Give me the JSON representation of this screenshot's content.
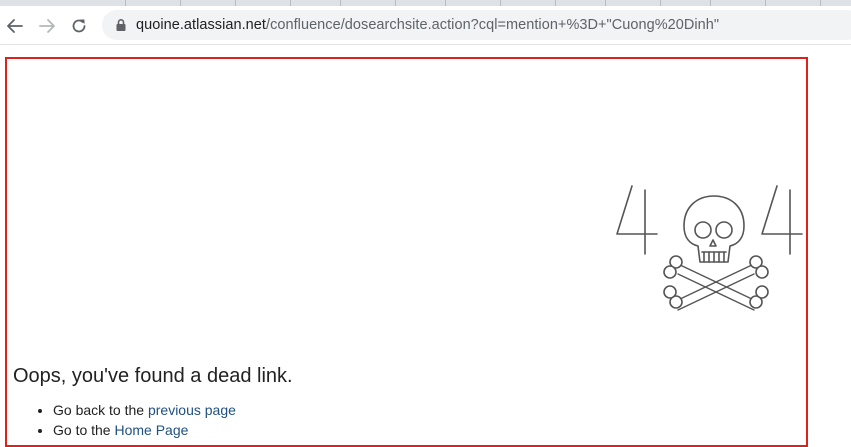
{
  "browser": {
    "back_icon": "arrow-left-icon",
    "forward_icon": "arrow-right-icon",
    "reload_icon": "reload-icon",
    "lock_icon": "lock-icon",
    "url_host": "quoine.atlassian.net",
    "url_path": "/confluence/dosearchsite.action?cql=mention+%3D+\"Cuong%20Dinh\""
  },
  "error_page": {
    "illustration_digit_left": "4",
    "illustration_digit_right": "4",
    "illustration_icon": "skull-crossbones-icon",
    "headline": "Oops, you've found a dead link.",
    "links": [
      {
        "prefix": "Go back to the ",
        "link_text": "previous page"
      },
      {
        "prefix": "Go to the ",
        "link_text": "Home Page"
      }
    ]
  },
  "colors": {
    "link": "#205081",
    "highlight_border": "#e0201c",
    "illustration_stroke": "#555555"
  }
}
